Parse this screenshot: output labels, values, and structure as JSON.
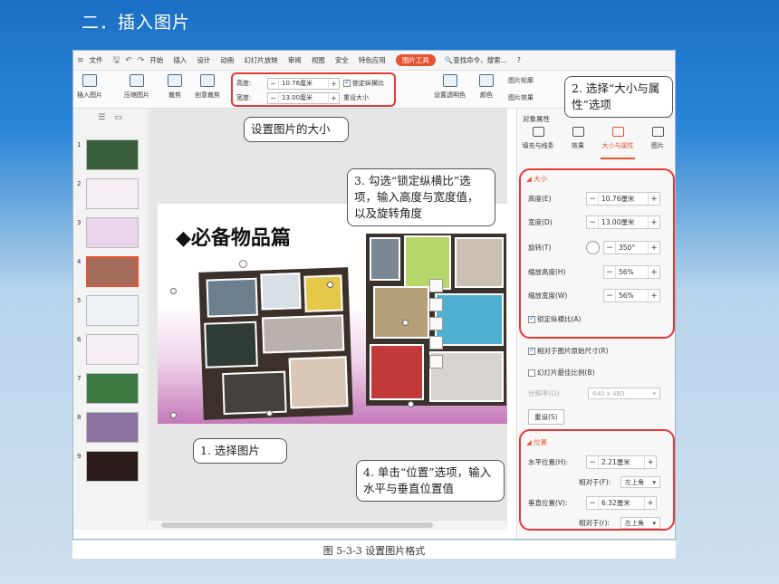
{
  "slide_title": "二．插入图片",
  "caption": "图 5-3-3  设置图片格式",
  "menubar": {
    "menu_label": "文件",
    "tabs": [
      "开始",
      "插入",
      "设计",
      "动画",
      "幻灯片放映",
      "审阅",
      "视图",
      "安全",
      "特色应用"
    ],
    "picture_tools": "图片工具",
    "search": "查找命令、搜索...",
    "help": "?"
  },
  "ribbon": {
    "insert_picture": "插入图片",
    "compress": "压缩图片",
    "crop": "裁剪",
    "creative_crop": "创意裁剪",
    "height_label": "高度:",
    "height_value": "10.76厘米",
    "width_label": "宽度:",
    "width_value": "13.00厘米",
    "lock_ratio": "锁定纵横比",
    "reset_size": "重设大小",
    "set_transparent": "设置透明色",
    "color": "颜色",
    "picture_outline": "图片轮廓",
    "picture_effect": "图片效果"
  },
  "thumbnails": [
    "1",
    "2",
    "3",
    "4",
    "5",
    "6",
    "7",
    "8",
    "9"
  ],
  "slide": {
    "heading": "◆必备物品篇"
  },
  "panel": {
    "title": "对象属性",
    "tabs": [
      "填充与线条",
      "效果",
      "大小与属性",
      "图片"
    ],
    "size_section": "大小",
    "height_label": "高度(E)",
    "height_value": "10.76厘米",
    "width_label": "宽度(D)",
    "width_value": "13.00厘米",
    "rotation_label": "旋转(T)",
    "rotation_value": "350°",
    "scale_h_label": "缩放高度(H)",
    "scale_h_value": "56%",
    "scale_w_label": "缩放宽度(W)",
    "scale_w_value": "56%",
    "lock_ratio": "锁定纵横比(A)",
    "relative_original": "相对于图片原始尺寸(R)",
    "best_scale": "幻灯片最佳比例(B)",
    "resolution_label": "分辨率(O)",
    "resolution_value": "640 x 480",
    "reset": "重设(S)",
    "position_section": "位置",
    "h_pos_label": "水平位置(H):",
    "h_pos_value": "2.21厘米",
    "relative_label_1": "相对于(F):",
    "relative_value_1": "左上角",
    "v_pos_label": "垂直位置(V):",
    "v_pos_value": "6.32厘米",
    "relative_label_2": "相对于(r):",
    "relative_value_2": "左上角"
  },
  "callouts": {
    "c1": "1. 选择图片",
    "c2": "2. 选择“大小与属性”选项",
    "c3": "3. 勾选“锁定纵横比”选项，输入高度与宽度值，以及旋转角度",
    "c4": "4. 单击“位置”选项，输入水平与垂直位置值",
    "size_note": "设置图片的大小"
  },
  "colors": {
    "accent": "#e8532f",
    "highlight": "#e53935",
    "bg_top": "#1a6fc4"
  }
}
